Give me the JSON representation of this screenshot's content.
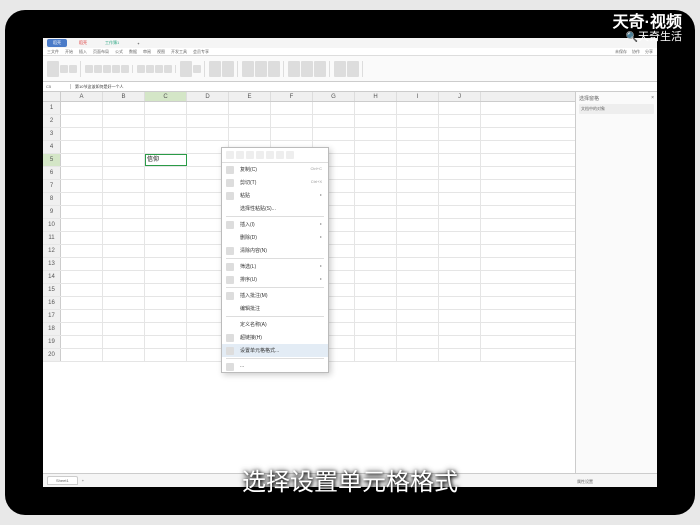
{
  "watermark": {
    "top": "天奇·视频",
    "sub": "天奇生活"
  },
  "tabs": {
    "t1": "稻壳",
    "t2": "稻壳",
    "t3": "工作簿1"
  },
  "menu": {
    "file": "三文件",
    "m1": "开始",
    "m2": "插入",
    "m3": "页面布局",
    "m4": "公式",
    "m5": "数据",
    "m6": "审阅",
    "m7": "视图",
    "m8": "开发工具",
    "m9": "会员专享",
    "r1": "未保存",
    "r2": "协作",
    "r3": "分享"
  },
  "formula_bar": {
    "ref": "C5",
    "content": "第10节这该如何是好一个人"
  },
  "columns": [
    "A",
    "B",
    "C",
    "D",
    "E",
    "F",
    "G",
    "H",
    "I",
    "J"
  ],
  "rows": [
    "1",
    "2",
    "3",
    "4",
    "5",
    "6",
    "7",
    "8",
    "9",
    "10",
    "11",
    "12",
    "13",
    "14",
    "15",
    "16",
    "17",
    "18",
    "19",
    "20"
  ],
  "active_cell_value": "信仰",
  "overflow_tail": "一个人",
  "context_menu": {
    "copy": "复制(C)",
    "copy_sc": "Ctrl+C",
    "cut": "剪切(T)",
    "cut_sc": "Ctrl+X",
    "paste": "粘贴",
    "paste_special": "选择性粘贴(S)...",
    "insert": "插入(I)",
    "delete": "删除(D)",
    "clear": "清除内容(N)",
    "filter": "筛选(L)",
    "sort": "排序(U)",
    "insert_comment": "插入批注(M)",
    "edit_comment": "编辑批注",
    "format_cells": "设置单元格格式(F)...",
    "define_name": "定义名称(A)",
    "hyperlink": "超链接(H)",
    "set_format": "设置单元格格式..."
  },
  "side_panel": {
    "title": "选择窗格",
    "item1": "文档中的对象"
  },
  "side_bottom": {
    "label": "属性设置"
  },
  "sheet": "Sheet1",
  "caption": "选择设置单元格格式"
}
